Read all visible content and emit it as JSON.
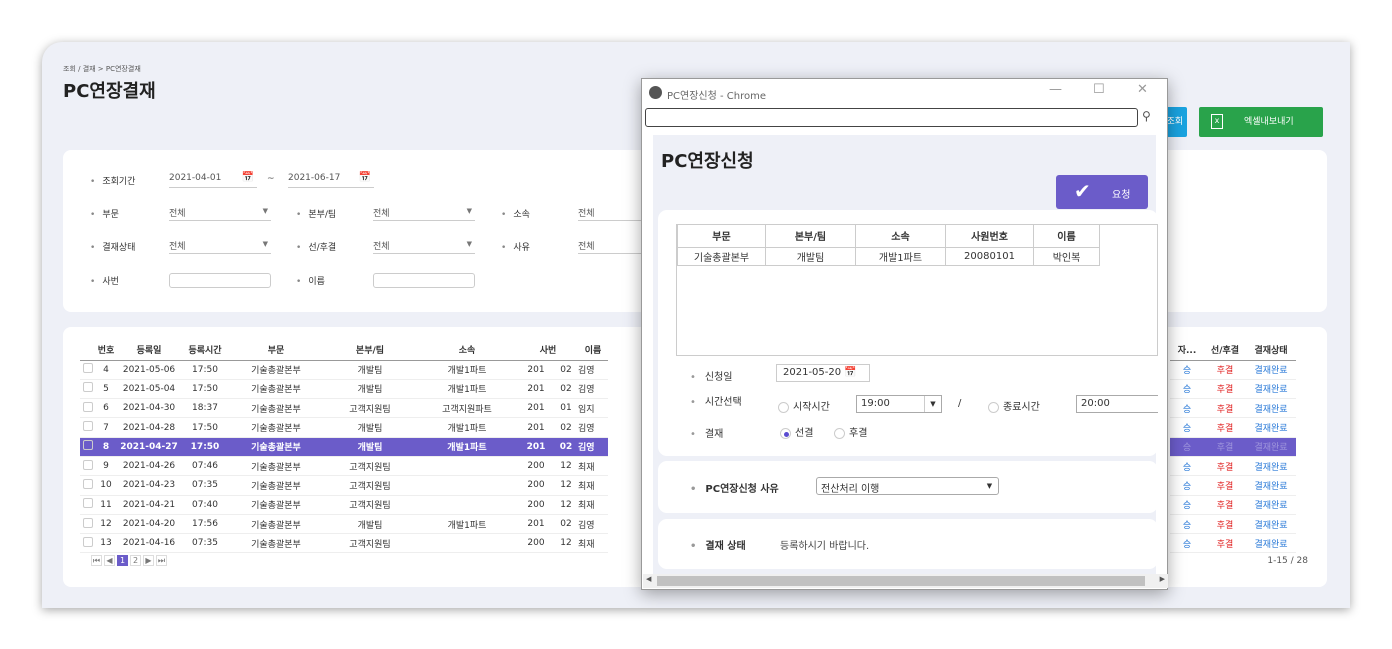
{
  "page": {
    "breadcrumb": "조회 / 결재 > PC연장결재",
    "title": "PC연장결재",
    "btn_search": "조회",
    "btn_excel": "엑셀내보내기"
  },
  "filter": {
    "period_label": "조회기간",
    "date_from": "2021-04-01",
    "tilde": "~",
    "date_to": "2021-06-17",
    "dept_label": "부문",
    "dept_value": "전체",
    "team_label": "본부/팀",
    "team_value": "전체",
    "unit_label": "소속",
    "unit_value": "전체",
    "status_label": "결재상태",
    "status_value": "전체",
    "prepost_label": "선/후결",
    "prepost_value": "전체",
    "reason_label": "사유",
    "reason_value": "전체",
    "empno_label": "사번",
    "name_label": "이름"
  },
  "table": {
    "headers": [
      "번호",
      "등록일",
      "등록시간",
      "부문",
      "본부/팀",
      "소속",
      "사번",
      "이름"
    ],
    "right_headers": [
      "자...",
      "선/후결",
      "결재상태"
    ],
    "rows": [
      {
        "no": "4",
        "date": "2021-05-06",
        "time": "17:50",
        "dept": "기술총괄본부",
        "team": "개발팀",
        "unit": "개발1파트",
        "e1": "201",
        "e2": "02",
        "name": "김영",
        "r1": "승",
        "r2": "후결",
        "r3": "결재완료"
      },
      {
        "no": "5",
        "date": "2021-05-04",
        "time": "17:50",
        "dept": "기술총괄본부",
        "team": "개발팀",
        "unit": "개발1파트",
        "e1": "201",
        "e2": "02",
        "name": "김영",
        "r1": "승",
        "r2": "후결",
        "r3": "결재완료"
      },
      {
        "no": "6",
        "date": "2021-04-30",
        "time": "18:37",
        "dept": "기술총괄본부",
        "team": "고객지원팀",
        "unit": "고객지원파트",
        "e1": "201",
        "e2": "01",
        "name": "임지",
        "r1": "승",
        "r2": "후결",
        "r3": "결재완료"
      },
      {
        "no": "7",
        "date": "2021-04-28",
        "time": "17:50",
        "dept": "기술총괄본부",
        "team": "개발팀",
        "unit": "개발1파트",
        "e1": "201",
        "e2": "02",
        "name": "김영",
        "r1": "승",
        "r2": "후결",
        "r3": "결재완료"
      },
      {
        "no": "8",
        "date": "2021-04-27",
        "time": "17:50",
        "dept": "기술총괄본부",
        "team": "개발팀",
        "unit": "개발1파트",
        "e1": "201",
        "e2": "02",
        "name": "김영",
        "r1": "승",
        "r2": "후결",
        "r3": "결재완료"
      },
      {
        "no": "9",
        "date": "2021-04-26",
        "time": "07:46",
        "dept": "기술총괄본부",
        "team": "고객지원팀",
        "unit": "",
        "e1": "200",
        "e2": "12",
        "name": "최재",
        "r1": "승",
        "r2": "후결",
        "r3": "결재완료"
      },
      {
        "no": "10",
        "date": "2021-04-23",
        "time": "07:35",
        "dept": "기술총괄본부",
        "team": "고객지원팀",
        "unit": "",
        "e1": "200",
        "e2": "12",
        "name": "최재",
        "r1": "승",
        "r2": "후결",
        "r3": "결재완료"
      },
      {
        "no": "11",
        "date": "2021-04-21",
        "time": "07:40",
        "dept": "기술총괄본부",
        "team": "고객지원팀",
        "unit": "",
        "e1": "200",
        "e2": "12",
        "name": "최재",
        "r1": "승",
        "r2": "후결",
        "r3": "결재완료"
      },
      {
        "no": "12",
        "date": "2021-04-20",
        "time": "17:56",
        "dept": "기술총괄본부",
        "team": "개발팀",
        "unit": "개발1파트",
        "e1": "201",
        "e2": "02",
        "name": "김영",
        "r1": "승",
        "r2": "후결",
        "r3": "결재완료"
      },
      {
        "no": "13",
        "date": "2021-04-16",
        "time": "07:35",
        "dept": "기술총괄본부",
        "team": "고객지원팀",
        "unit": "",
        "e1": "200",
        "e2": "12",
        "name": "최재",
        "r1": "승",
        "r2": "후결",
        "r3": "결재완료"
      }
    ],
    "selected_index": 4,
    "pager": {
      "first": "⏮",
      "prev": "◀",
      "p1": "1",
      "p2": "2",
      "next": "▶",
      "last": "⏭"
    },
    "count": "1-15 / 28"
  },
  "popup": {
    "window_title": "PC연장신청 - Chrome",
    "min": "—",
    "max": "☐",
    "close": "✕",
    "heading": "PC연장신청",
    "request_label": "요청",
    "check": "✔",
    "emp_headers": [
      "부문",
      "본부/팀",
      "소속",
      "사원번호",
      "이름"
    ],
    "emp_row": [
      "기술총괄본부",
      "개발팀",
      "개발1파트",
      "20080101",
      "박인복"
    ],
    "apply_date_label": "신청일",
    "apply_date": "2021-05-20",
    "time_label": "시간선택",
    "start_label": "시작시간",
    "start_value": "19:00",
    "slash": "/",
    "end_label": "종료시간",
    "end_value": "20:00",
    "approval_label": "결재",
    "pre_label": "선결",
    "post_label": "후결",
    "reason_label": "PC연장신청 사유",
    "reason_value": "전산처리 이행",
    "status_label": "결재 상태",
    "status_text": "등록하시기 바랍니다."
  }
}
